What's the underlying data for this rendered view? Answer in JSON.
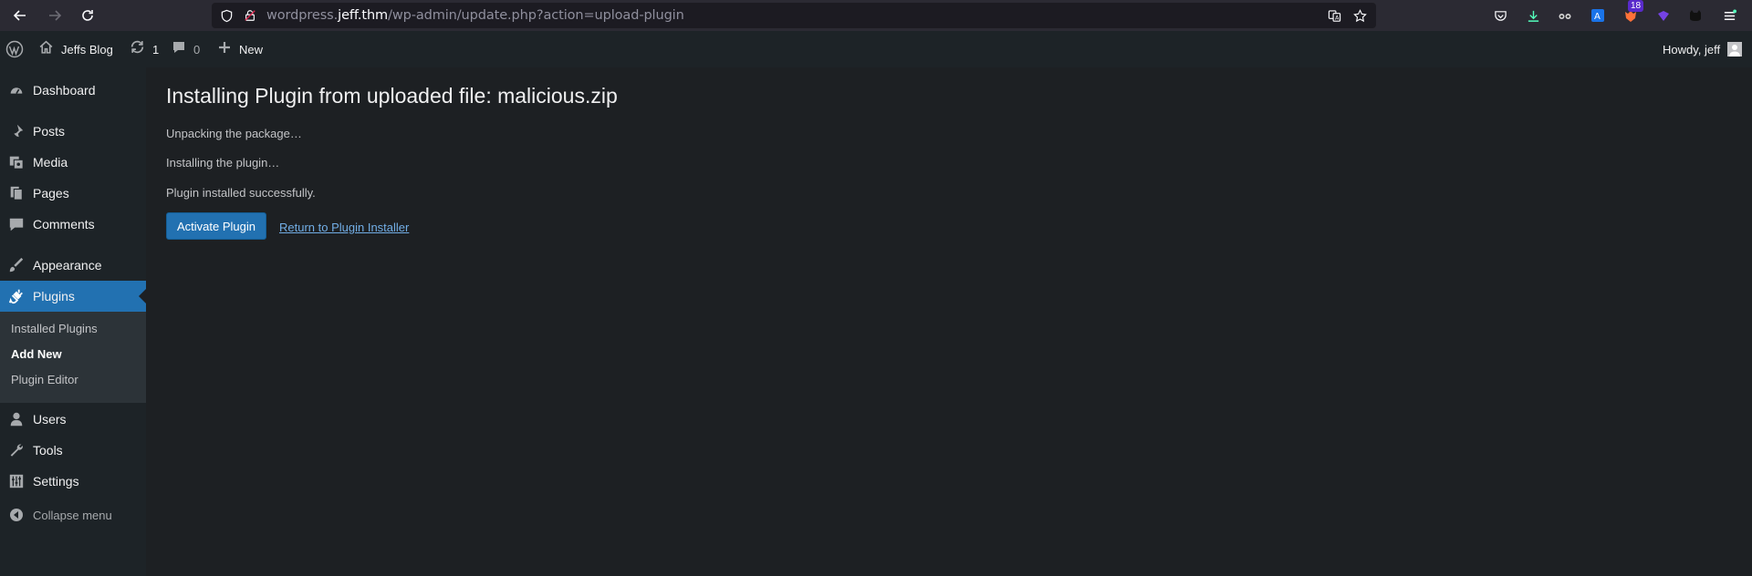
{
  "browser": {
    "url_prefix": "wordpress.",
    "url_host": "jeff.thm",
    "url_path": "/wp-admin/update.php?action=upload-plugin",
    "extension_badge": "18"
  },
  "adminbar": {
    "site_name": "Jeffs Blog",
    "updates_count": "1",
    "comments_count": "0",
    "new_label": "New",
    "howdy": "Howdy, jeff"
  },
  "sidebar": {
    "items": [
      {
        "label": "Dashboard",
        "icon": "dashboard-icon"
      },
      {
        "label": "Posts",
        "icon": "pin-icon"
      },
      {
        "label": "Media",
        "icon": "media-icon"
      },
      {
        "label": "Pages",
        "icon": "pages-icon"
      },
      {
        "label": "Comments",
        "icon": "comment-icon"
      },
      {
        "label": "Appearance",
        "icon": "brush-icon"
      },
      {
        "label": "Plugins",
        "icon": "plug-icon"
      },
      {
        "label": "Users",
        "icon": "user-icon"
      },
      {
        "label": "Tools",
        "icon": "wrench-icon"
      },
      {
        "label": "Settings",
        "icon": "settings-icon"
      }
    ],
    "submenu": [
      {
        "label": "Installed Plugins"
      },
      {
        "label": "Add New"
      },
      {
        "label": "Plugin Editor"
      }
    ],
    "collapse_label": "Collapse menu"
  },
  "main": {
    "title": "Installing Plugin from uploaded file: malicious.zip",
    "messages": [
      "Unpacking the package…",
      "Installing the plugin…",
      "Plugin installed successfully."
    ],
    "activate_label": "Activate Plugin",
    "return_link": "Return to Plugin Installer"
  },
  "colors": {
    "accent": "#2271b1",
    "link": "#72aee6",
    "bg": "#1d2023",
    "sidebar": "#1d2327"
  }
}
